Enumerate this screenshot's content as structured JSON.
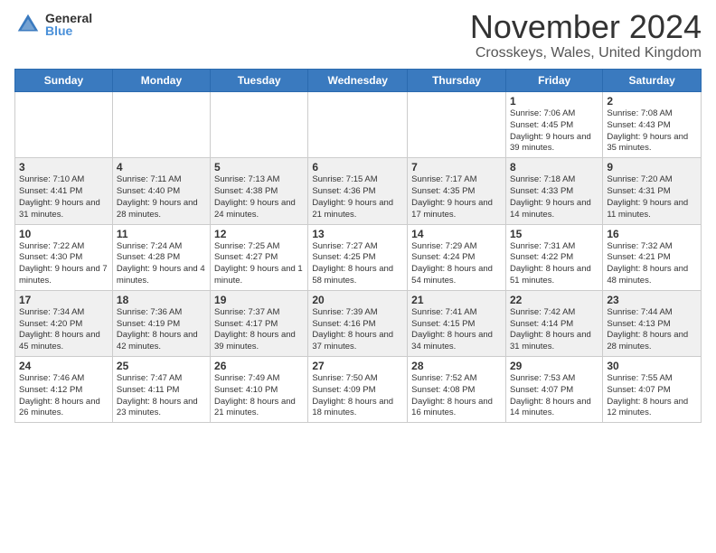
{
  "logo": {
    "general": "General",
    "blue": "Blue"
  },
  "header": {
    "month": "November 2024",
    "location": "Crosskeys, Wales, United Kingdom"
  },
  "days_of_week": [
    "Sunday",
    "Monday",
    "Tuesday",
    "Wednesday",
    "Thursday",
    "Friday",
    "Saturday"
  ],
  "weeks": [
    {
      "days": [
        {
          "num": "",
          "info": ""
        },
        {
          "num": "",
          "info": ""
        },
        {
          "num": "",
          "info": ""
        },
        {
          "num": "",
          "info": ""
        },
        {
          "num": "",
          "info": ""
        },
        {
          "num": "1",
          "info": "Sunrise: 7:06 AM\nSunset: 4:45 PM\nDaylight: 9 hours\nand 39 minutes."
        },
        {
          "num": "2",
          "info": "Sunrise: 7:08 AM\nSunset: 4:43 PM\nDaylight: 9 hours\nand 35 minutes."
        }
      ]
    },
    {
      "days": [
        {
          "num": "3",
          "info": "Sunrise: 7:10 AM\nSunset: 4:41 PM\nDaylight: 9 hours\nand 31 minutes."
        },
        {
          "num": "4",
          "info": "Sunrise: 7:11 AM\nSunset: 4:40 PM\nDaylight: 9 hours\nand 28 minutes."
        },
        {
          "num": "5",
          "info": "Sunrise: 7:13 AM\nSunset: 4:38 PM\nDaylight: 9 hours\nand 24 minutes."
        },
        {
          "num": "6",
          "info": "Sunrise: 7:15 AM\nSunset: 4:36 PM\nDaylight: 9 hours\nand 21 minutes."
        },
        {
          "num": "7",
          "info": "Sunrise: 7:17 AM\nSunset: 4:35 PM\nDaylight: 9 hours\nand 17 minutes."
        },
        {
          "num": "8",
          "info": "Sunrise: 7:18 AM\nSunset: 4:33 PM\nDaylight: 9 hours\nand 14 minutes."
        },
        {
          "num": "9",
          "info": "Sunrise: 7:20 AM\nSunset: 4:31 PM\nDaylight: 9 hours\nand 11 minutes."
        }
      ]
    },
    {
      "days": [
        {
          "num": "10",
          "info": "Sunrise: 7:22 AM\nSunset: 4:30 PM\nDaylight: 9 hours\nand 7 minutes."
        },
        {
          "num": "11",
          "info": "Sunrise: 7:24 AM\nSunset: 4:28 PM\nDaylight: 9 hours\nand 4 minutes."
        },
        {
          "num": "12",
          "info": "Sunrise: 7:25 AM\nSunset: 4:27 PM\nDaylight: 9 hours\nand 1 minute."
        },
        {
          "num": "13",
          "info": "Sunrise: 7:27 AM\nSunset: 4:25 PM\nDaylight: 8 hours\nand 58 minutes."
        },
        {
          "num": "14",
          "info": "Sunrise: 7:29 AM\nSunset: 4:24 PM\nDaylight: 8 hours\nand 54 minutes."
        },
        {
          "num": "15",
          "info": "Sunrise: 7:31 AM\nSunset: 4:22 PM\nDaylight: 8 hours\nand 51 minutes."
        },
        {
          "num": "16",
          "info": "Sunrise: 7:32 AM\nSunset: 4:21 PM\nDaylight: 8 hours\nand 48 minutes."
        }
      ]
    },
    {
      "days": [
        {
          "num": "17",
          "info": "Sunrise: 7:34 AM\nSunset: 4:20 PM\nDaylight: 8 hours\nand 45 minutes."
        },
        {
          "num": "18",
          "info": "Sunrise: 7:36 AM\nSunset: 4:19 PM\nDaylight: 8 hours\nand 42 minutes."
        },
        {
          "num": "19",
          "info": "Sunrise: 7:37 AM\nSunset: 4:17 PM\nDaylight: 8 hours\nand 39 minutes."
        },
        {
          "num": "20",
          "info": "Sunrise: 7:39 AM\nSunset: 4:16 PM\nDaylight: 8 hours\nand 37 minutes."
        },
        {
          "num": "21",
          "info": "Sunrise: 7:41 AM\nSunset: 4:15 PM\nDaylight: 8 hours\nand 34 minutes."
        },
        {
          "num": "22",
          "info": "Sunrise: 7:42 AM\nSunset: 4:14 PM\nDaylight: 8 hours\nand 31 minutes."
        },
        {
          "num": "23",
          "info": "Sunrise: 7:44 AM\nSunset: 4:13 PM\nDaylight: 8 hours\nand 28 minutes."
        }
      ]
    },
    {
      "days": [
        {
          "num": "24",
          "info": "Sunrise: 7:46 AM\nSunset: 4:12 PM\nDaylight: 8 hours\nand 26 minutes."
        },
        {
          "num": "25",
          "info": "Sunrise: 7:47 AM\nSunset: 4:11 PM\nDaylight: 8 hours\nand 23 minutes."
        },
        {
          "num": "26",
          "info": "Sunrise: 7:49 AM\nSunset: 4:10 PM\nDaylight: 8 hours\nand 21 minutes."
        },
        {
          "num": "27",
          "info": "Sunrise: 7:50 AM\nSunset: 4:09 PM\nDaylight: 8 hours\nand 18 minutes."
        },
        {
          "num": "28",
          "info": "Sunrise: 7:52 AM\nSunset: 4:08 PM\nDaylight: 8 hours\nand 16 minutes."
        },
        {
          "num": "29",
          "info": "Sunrise: 7:53 AM\nSunset: 4:07 PM\nDaylight: 8 hours\nand 14 minutes."
        },
        {
          "num": "30",
          "info": "Sunrise: 7:55 AM\nSunset: 4:07 PM\nDaylight: 8 hours\nand 12 minutes."
        }
      ]
    }
  ]
}
